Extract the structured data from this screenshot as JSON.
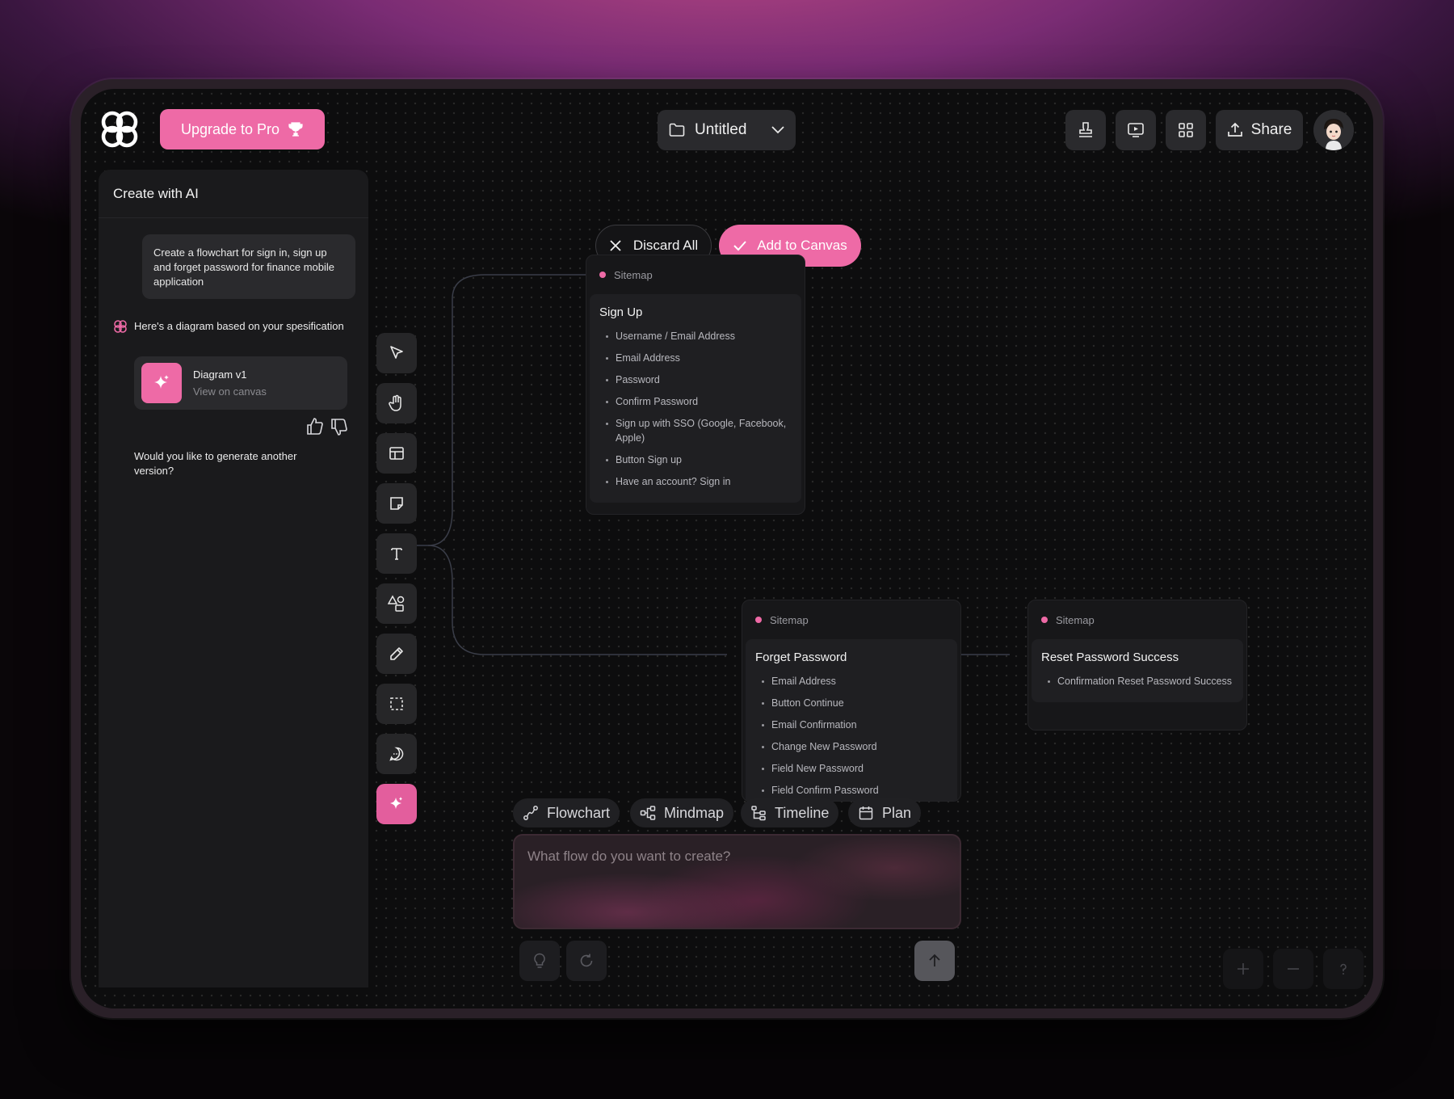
{
  "header": {
    "upgrade_label": "Upgrade to Pro",
    "file_title": "Untitled",
    "share_label": "Share",
    "icons": [
      "stamp-icon",
      "present-icon",
      "grid-icon",
      "upload-icon"
    ]
  },
  "sidebar": {
    "title": "Create with AI",
    "user_prompt": "Create a flowchart for sign in, sign up and forget password for finance mobile application",
    "ai_reply": "Here's a diagram based on your spesification",
    "diagram_card": {
      "title": "Diagram v1",
      "link": "View on canvas"
    },
    "followup": "Would you like to generate another version?"
  },
  "toolbar": {
    "tools": [
      "select",
      "hand",
      "layout",
      "sticky-note",
      "text",
      "shapes",
      "pen",
      "frame",
      "comment",
      "ai"
    ]
  },
  "canvas": {
    "discard_label": "Discard All",
    "add_label": "Add to Canvas",
    "nodes": {
      "signup": {
        "tag": "Sitemap",
        "title": "Sign Up",
        "items": [
          "Username / Email Address",
          "Email Address",
          "Password",
          "Confirm Password",
          "Sign up with SSO (Google, Facebook, Apple)",
          "Button Sign up",
          "Have an account? Sign in"
        ]
      },
      "forget": {
        "tag": "Sitemap",
        "title": "Forget Password",
        "items": [
          "Email Address",
          "Button Continue",
          "Email Confirmation",
          "Change New Password",
          "Field New Password",
          "Field Confirm Password"
        ]
      },
      "reset": {
        "tag": "Sitemap",
        "title": "Reset Password Success",
        "items": [
          "Confirmation Reset Password Success"
        ]
      }
    }
  },
  "prompt": {
    "types": [
      "Flowchart",
      "Mindmap",
      "Timeline",
      "Plan"
    ],
    "placeholder": "What flow do you want to create?"
  },
  "colors": {
    "accent": "#ee6aa6",
    "panel": "#1a1a1c",
    "canvas": "#0d0d0e"
  }
}
